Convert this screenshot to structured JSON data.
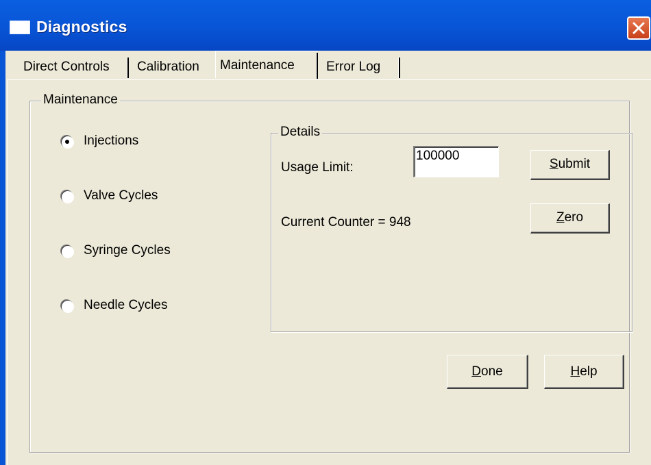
{
  "window": {
    "title": "Diagnostics",
    "accent": "#0855d6",
    "face": "#ece9d8"
  },
  "tabs": [
    {
      "label": "Direct Controls",
      "active": false
    },
    {
      "label": "Calibration",
      "active": false
    },
    {
      "label": "Maintenance",
      "active": true
    },
    {
      "label": "Error Log",
      "active": false
    }
  ],
  "maintenance": {
    "group_label": "Maintenance",
    "options": [
      {
        "label": "Injections",
        "selected": true
      },
      {
        "label": "Valve Cycles",
        "selected": false
      },
      {
        "label": "Syringe Cycles",
        "selected": false
      },
      {
        "label": "Needle Cycles",
        "selected": false
      }
    ]
  },
  "details": {
    "group_label": "Details",
    "usage_limit_label": "Usage Limit:",
    "usage_limit_value": "100000",
    "counter_text": "Current Counter = 948",
    "submit": {
      "mnemonic": "S",
      "rest": "ubmit"
    },
    "zero": {
      "mnemonic": "Z",
      "rest": "ero"
    }
  },
  "footer": {
    "done": {
      "mnemonic": "D",
      "rest": "one"
    },
    "help": {
      "mnemonic": "H",
      "rest": "elp"
    }
  },
  "icons": {
    "close": "close-icon",
    "app": "window-icon"
  }
}
